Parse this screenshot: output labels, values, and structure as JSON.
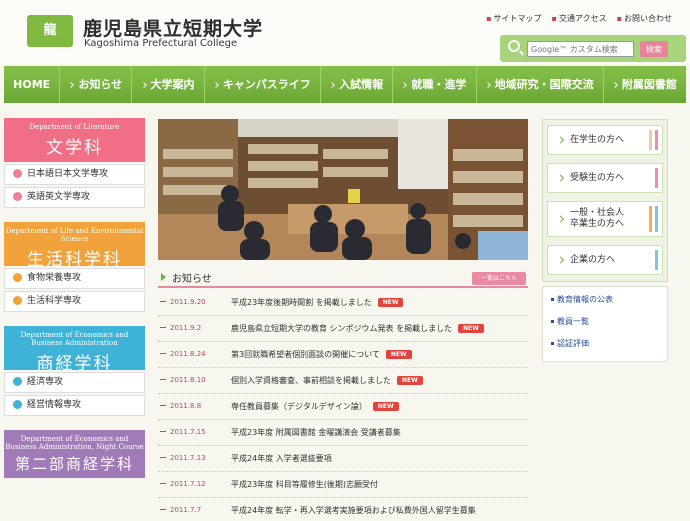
{
  "header": {
    "logo_text": "⿓",
    "title": "鹿児島県立短期大学",
    "subtitle": "Kagoshima Prefectural College",
    "top_links": [
      "サイトマップ",
      "交通アクセス",
      "お問い合わせ"
    ],
    "search_placeholder": "Google™ カスタム検索",
    "search_button": "検索"
  },
  "nav": {
    "items": [
      "HOME",
      "お知らせ",
      "大学案内",
      "キャンパスライフ",
      "入試情報",
      "就職・進学",
      "地域研究・国際交流",
      "附属図書館"
    ]
  },
  "departments": [
    {
      "en": "Department of Literature",
      "ja": "文学科",
      "color": "#f06f86",
      "items": [
        "日本語日本文学専攻",
        "英語英文学専攻"
      ],
      "dot": "#f07f95"
    },
    {
      "en": "Department of Life and Environmental Science",
      "ja": "生活科学科",
      "color": "#f2a23a",
      "items": [
        "食物栄養専攻",
        "生活科学専攻"
      ],
      "dot": "#f2a23a"
    },
    {
      "en": "Department of Economics and Business Administration",
      "ja": "商経学科",
      "color": "#3fb2d8",
      "items": [
        "経済専攻",
        "経営情報専攻"
      ],
      "dot": "#3fb2d8"
    },
    {
      "en": "Department of Economics and Business Administration, Night Course",
      "ja": "第二部商経学科",
      "color": "#a07bb8",
      "items": [],
      "dot": "#a07bb8"
    }
  ],
  "news": {
    "title": "お知らせ",
    "list_button": "一覧はこちら",
    "new_label": "NEW",
    "items": [
      {
        "date": "2011.9.20",
        "text": "平成23年度後期時間割 を掲載しました",
        "new": true
      },
      {
        "date": "2011.9.2",
        "text": "鹿児島県立短期大学の教育 シンポジウム発表 を掲載しました",
        "new": true
      },
      {
        "date": "2011.8.24",
        "text": "第3回就職希望者個別面談の開催について",
        "new": true
      },
      {
        "date": "2011.8.10",
        "text": "個別入学資格審査、事前相談を掲載しました",
        "new": true
      },
      {
        "date": "2011.8.8",
        "text": "専任教員募集（デジタルデザイン論）",
        "new": true
      },
      {
        "date": "2011.7.15",
        "text": "平成23年度 附属図書館 金曜講演会 受講者募集",
        "new": false
      },
      {
        "date": "2011.7.13",
        "text": "平成24年度 入学者選抜要項",
        "new": false
      },
      {
        "date": "2011.7.12",
        "text": "平成23年度 科目等履修生(後期)志願受付",
        "new": false
      },
      {
        "date": "2011.7.7",
        "text": "平成24年度 転学・再入学選考実施要項および私費外国人留学生募集",
        "new": false
      }
    ]
  },
  "audience": [
    {
      "label": "在学生の方へ",
      "stripes": [
        "#f3c6a6",
        "#f08da2"
      ]
    },
    {
      "label": "受験生の方へ",
      "stripes": [
        "#f08da2"
      ]
    },
    {
      "label": "一般・社会人\n卒業生の方へ",
      "stripes": [
        "#f2b04a",
        "#7fc6e3"
      ]
    },
    {
      "label": "企業の方へ",
      "stripes": [
        "#7fc6e3"
      ]
    }
  ],
  "info_links": [
    "教育情報の公表",
    "教員一覧",
    "認証評価"
  ]
}
